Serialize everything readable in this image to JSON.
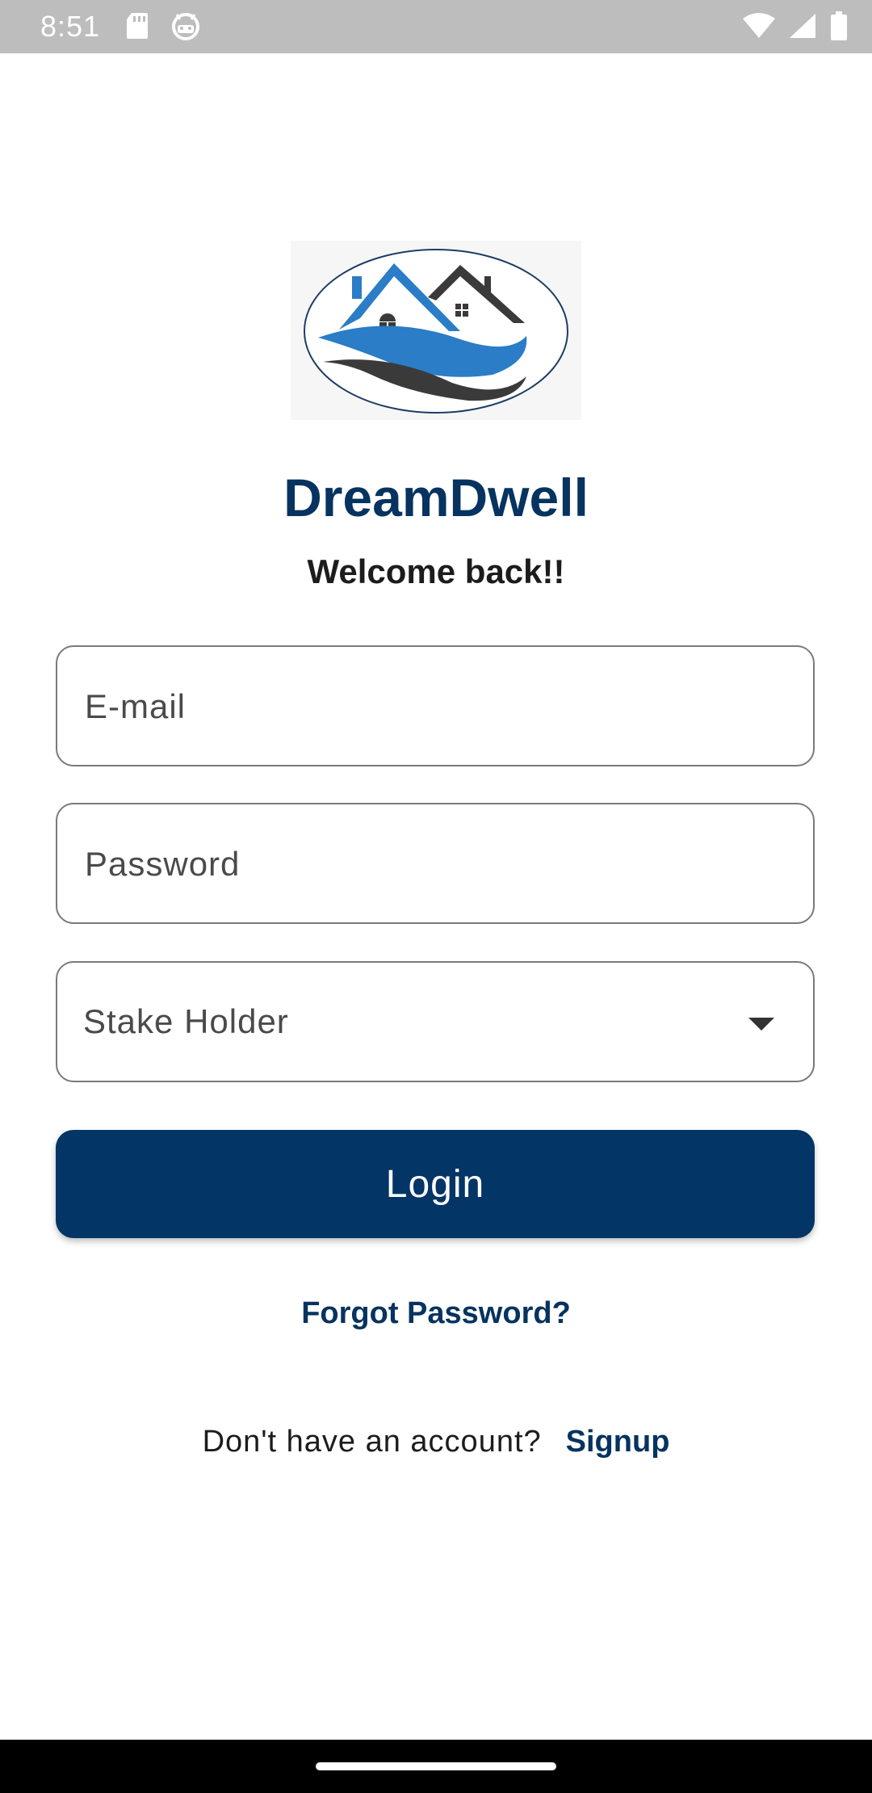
{
  "status_bar": {
    "time": "8:51",
    "left_icons": [
      "sd-card-icon",
      "android-icon"
    ],
    "right_icons": [
      "wifi-icon",
      "signal-icon",
      "battery-icon"
    ]
  },
  "app": {
    "title": "DreamDwell",
    "welcome": "Welcome back!!",
    "logo": "house-logo-icon"
  },
  "form": {
    "email_placeholder": "E-mail",
    "password_placeholder": "Password",
    "stakeholder_label": "Stake Holder",
    "login_label": "Login",
    "forgot_password": "Forgot Password?",
    "signup_prompt": "Don't have an account?",
    "signup_link": "Signup"
  },
  "colors": {
    "brand": "#06335f",
    "button": "#033566",
    "logo_blue": "#2a7dc6",
    "logo_dark": "#3a3a3a"
  }
}
